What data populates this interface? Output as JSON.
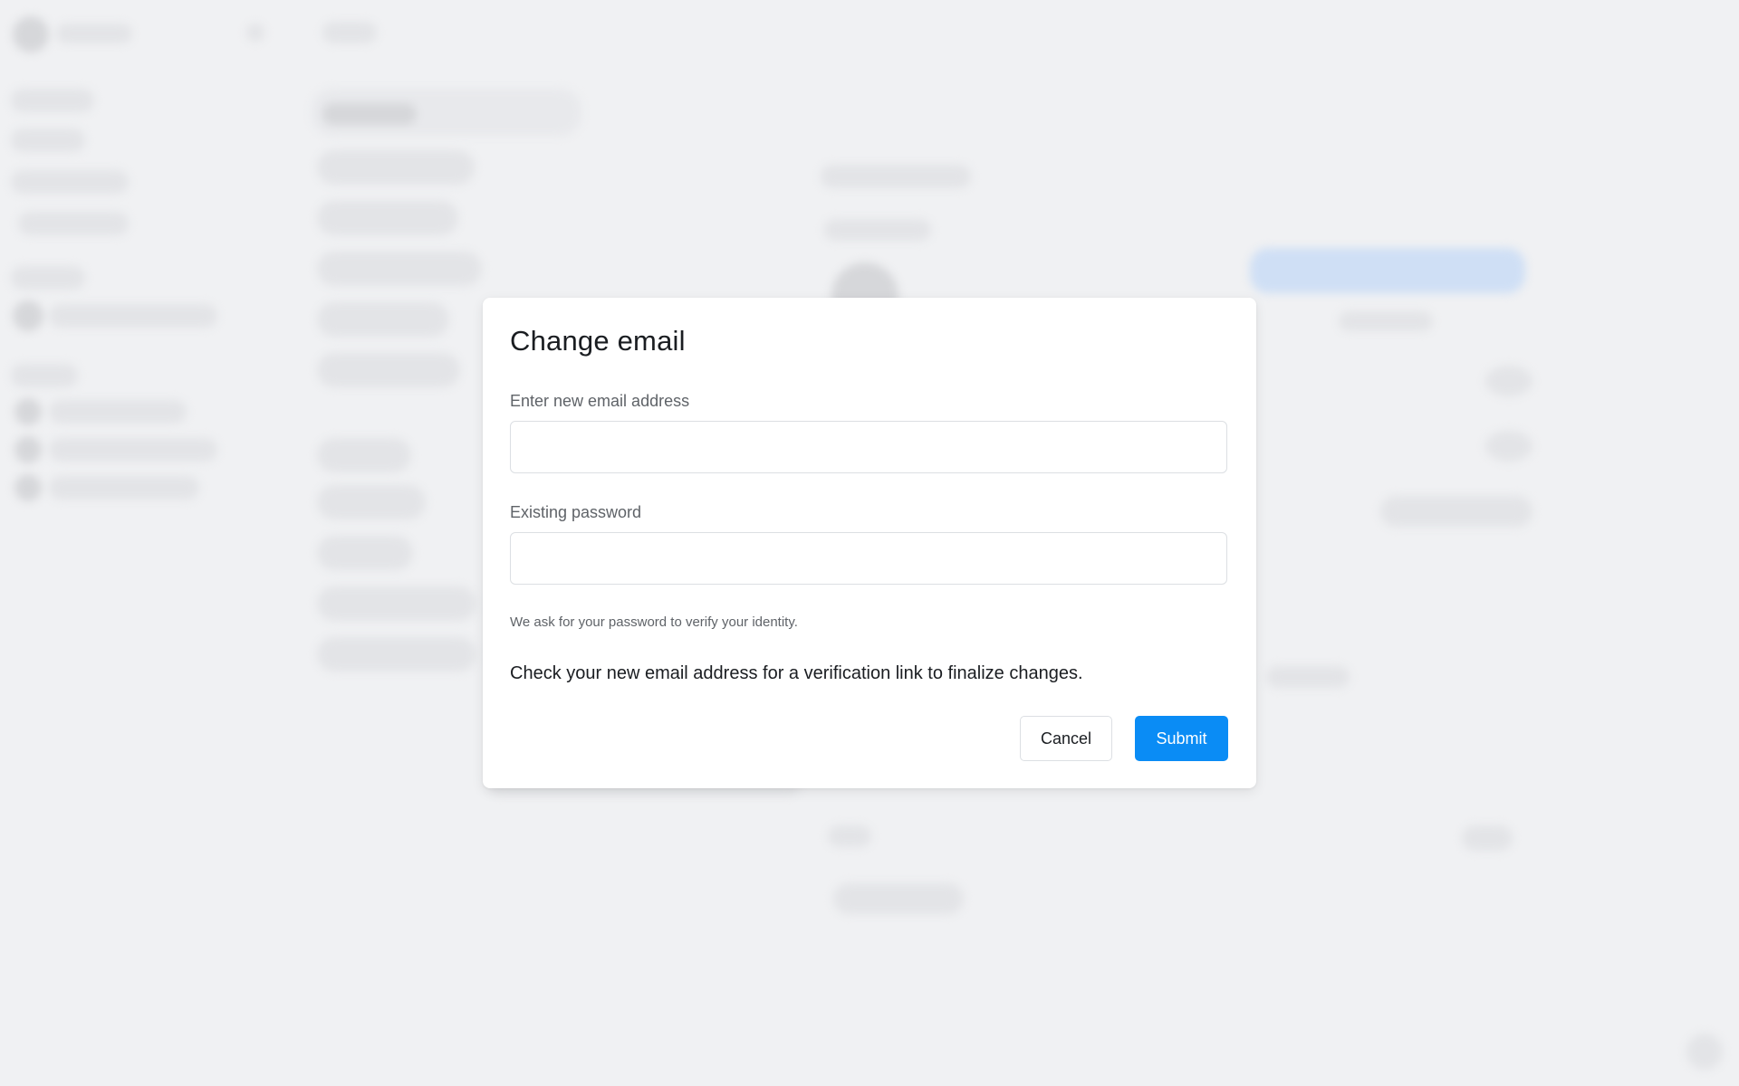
{
  "modal": {
    "title": "Change email",
    "email_label": "Enter new email address",
    "email_value": "",
    "password_label": "Existing password",
    "password_value": "",
    "password_hint": "We ask for your password to verify your identity.",
    "notice": "Check your new email address for a verification link to finalize changes.",
    "cancel_label": "Cancel",
    "submit_label": "Submit"
  },
  "colors": {
    "primary": "#0a8cf5",
    "background": "#f0f1f3",
    "text": "#1a1d21",
    "muted_text": "#5f6368",
    "border": "#dcdfe3"
  }
}
